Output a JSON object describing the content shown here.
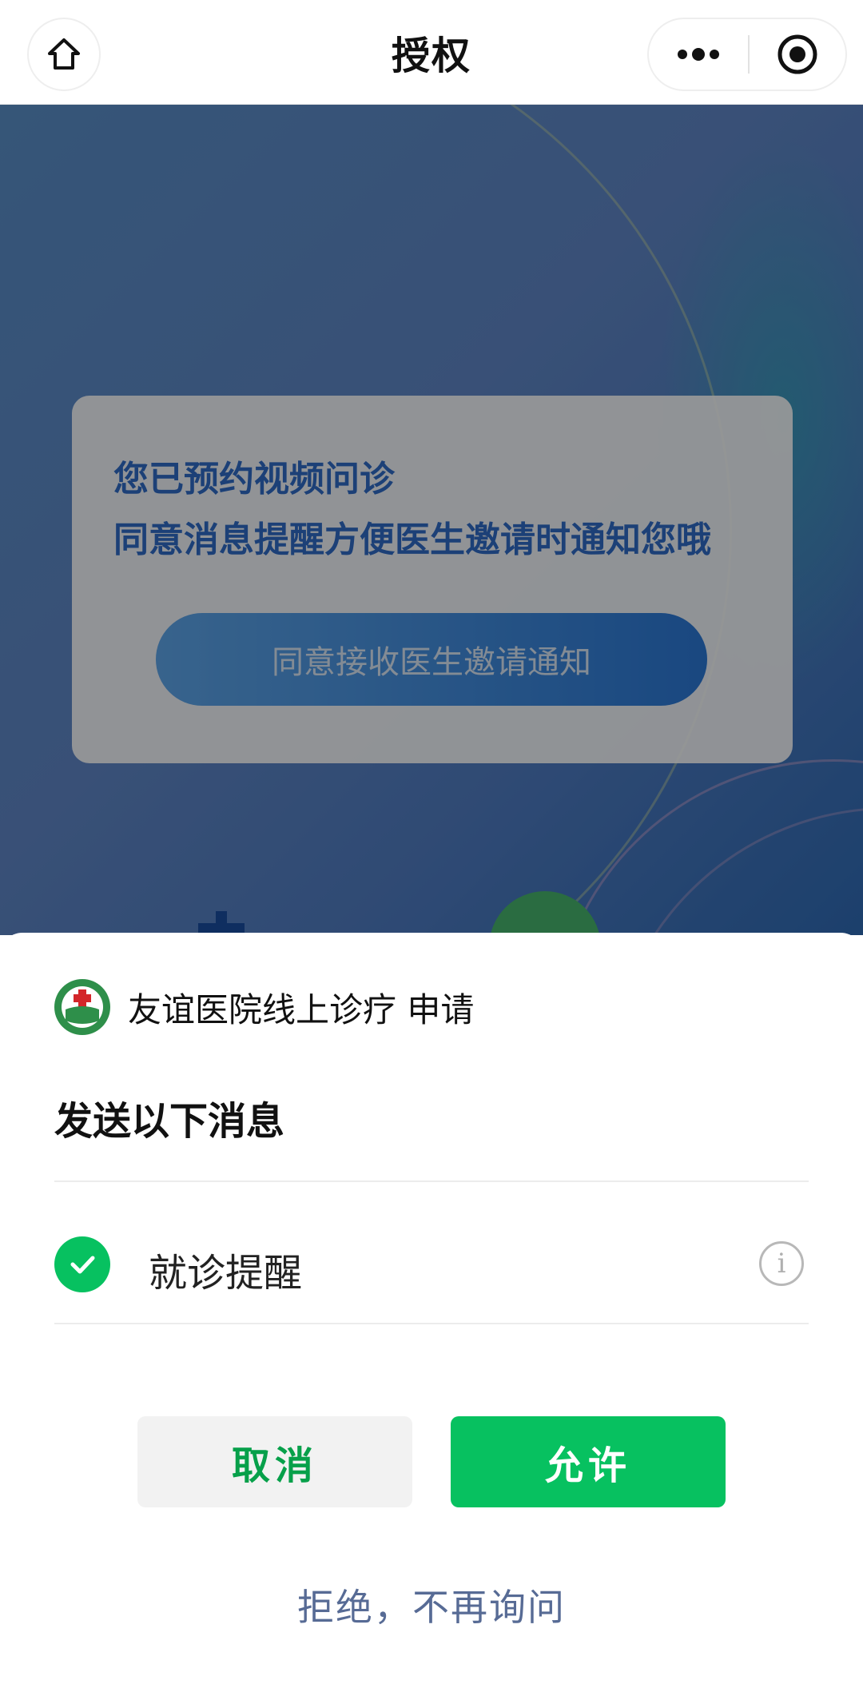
{
  "header": {
    "title": "授权"
  },
  "background_page": {
    "promo_line1": "您已预约视频问诊",
    "promo_line2": "同意消息提醒方便医生邀请时通知您哦",
    "promo_button": "同意接收医生邀请通知"
  },
  "sheet": {
    "app_name": "友谊医院线上诊疗 申请",
    "heading": "发送以下消息",
    "permission": {
      "label": "就诊提醒",
      "checked": true
    },
    "cancel_label": "取消",
    "allow_label": "允许",
    "reject_label": "拒绝，不再询问"
  },
  "colors": {
    "accent_green": "#07c160",
    "link_blue": "#576b95"
  }
}
